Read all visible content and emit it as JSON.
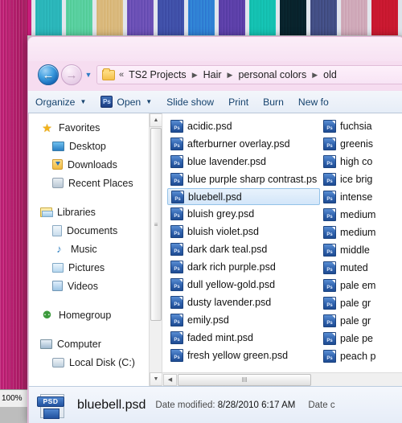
{
  "backdrop": {
    "zoom_level": "100%",
    "strips": [
      {
        "name": "magenta-strip",
        "color": "#c61c78"
      },
      {
        "name": "teal-strip",
        "color": "#2ab5b9"
      },
      {
        "name": "mint-green-strip",
        "color": "#57cf9d"
      },
      {
        "name": "tan-gold-strip",
        "color": "#d9b87a"
      },
      {
        "name": "violet-strip",
        "color": "#6a4fb5"
      },
      {
        "name": "indigo-blue-strip",
        "color": "#3f4fa8"
      },
      {
        "name": "bright-blue-strip",
        "color": "#2f7fd4"
      },
      {
        "name": "deep-purple-strip",
        "color": "#5b3fa8"
      },
      {
        "name": "turquoise-strip",
        "color": "#14c0b0"
      },
      {
        "name": "near-black-teal-strip",
        "color": "#08222b"
      },
      {
        "name": "slate-blue-strip",
        "color": "#414d83"
      },
      {
        "name": "dusty-rose-strip",
        "color": "#cfa8b8"
      },
      {
        "name": "crimson-strip",
        "color": "#c8182f"
      }
    ],
    "left_strip_color": "#c61c78"
  },
  "address_bar": {
    "back_glyph": "←",
    "forward_glyph": "→",
    "history_glyph": "▼",
    "overflow_glyph": "«",
    "separator_glyph": "▶",
    "crumbs": [
      "TS2 Projects",
      "Hair",
      "personal colors",
      "old"
    ]
  },
  "toolbar": {
    "organize_label": "Organize",
    "open_label": "Open",
    "open_icon_text": "Ps",
    "slideshow_label": "Slide show",
    "print_label": "Print",
    "burn_label": "Burn",
    "newfolder_label": "New fo",
    "caret_glyph": "▼"
  },
  "nav_pane": {
    "items": [
      {
        "label": "Favorites",
        "icon": "star-icon",
        "icon_class": "ico-star",
        "glyph": "★",
        "indent": false
      },
      {
        "label": "Desktop",
        "icon": "desktop-icon",
        "icon_class": "ico-desktop",
        "glyph": "",
        "indent": true
      },
      {
        "label": "Downloads",
        "icon": "downloads-folder-icon",
        "icon_class": "ico-dl",
        "glyph": "",
        "indent": true
      },
      {
        "label": "Recent Places",
        "icon": "recent-places-icon",
        "icon_class": "ico-recent",
        "glyph": "",
        "indent": true
      },
      {
        "label": "",
        "icon": "",
        "icon_class": "",
        "glyph": "",
        "indent": false,
        "spacer": true
      },
      {
        "label": "Libraries",
        "icon": "libraries-icon",
        "icon_class": "ico-lib",
        "glyph": "",
        "indent": false
      },
      {
        "label": "Documents",
        "icon": "documents-icon",
        "icon_class": "ico-doc",
        "glyph": "",
        "indent": true
      },
      {
        "label": "Music",
        "icon": "music-icon",
        "icon_class": "ico-music",
        "glyph": "♪",
        "indent": true
      },
      {
        "label": "Pictures",
        "icon": "pictures-icon",
        "icon_class": "ico-pic",
        "glyph": "",
        "indent": true
      },
      {
        "label": "Videos",
        "icon": "videos-icon",
        "icon_class": "ico-vid",
        "glyph": "",
        "indent": true
      },
      {
        "label": "",
        "icon": "",
        "icon_class": "",
        "glyph": "",
        "indent": false,
        "spacer": true
      },
      {
        "label": "Homegroup",
        "icon": "homegroup-icon",
        "icon_class": "ico-home",
        "glyph": "⚉",
        "indent": false
      },
      {
        "label": "",
        "icon": "",
        "icon_class": "",
        "glyph": "",
        "indent": false,
        "spacer": true
      },
      {
        "label": "Computer",
        "icon": "computer-icon",
        "icon_class": "ico-comp",
        "glyph": "",
        "indent": false
      },
      {
        "label": "Local Disk (C:)",
        "icon": "local-disk-icon",
        "icon_class": "ico-disk",
        "glyph": "",
        "indent": true
      }
    ],
    "scroll_up_glyph": "▲",
    "scroll_down_glyph": "▼",
    "thumb_grip": "≡"
  },
  "file_list": {
    "icon_label": "Ps",
    "selected": "bluebell.psd",
    "column1": [
      "acidic.psd",
      "afterburner overlay.psd",
      "blue lavender.psd",
      "blue purple sharp contrast.psd",
      "bluebell.psd",
      "bluish grey.psd",
      "bluish violet.psd",
      "dark dark teal.psd",
      "dark rich purple.psd",
      "dull yellow-gold.psd",
      "dusty lavender.psd",
      "emily.psd",
      "faded mint.psd",
      "fresh yellow green.psd"
    ],
    "column2": [
      "fuchsia",
      "greenis",
      "high co",
      "ice brig",
      "intense",
      "medium",
      "medium",
      "middle",
      "muted",
      "pale em",
      "pale gr",
      "pale gr",
      "pale pe",
      "peach p"
    ],
    "hscroll_left_glyph": "◀",
    "hscroll_right_glyph": "▶",
    "hthumb_grip": "‖‖"
  },
  "details_pane": {
    "file_name": "bluebell.psd",
    "icon_badge": "PSD",
    "date_modified_label": "Date modified:",
    "date_modified_value": "8/28/2010 6:17 AM",
    "date_created_label": "Date c"
  }
}
